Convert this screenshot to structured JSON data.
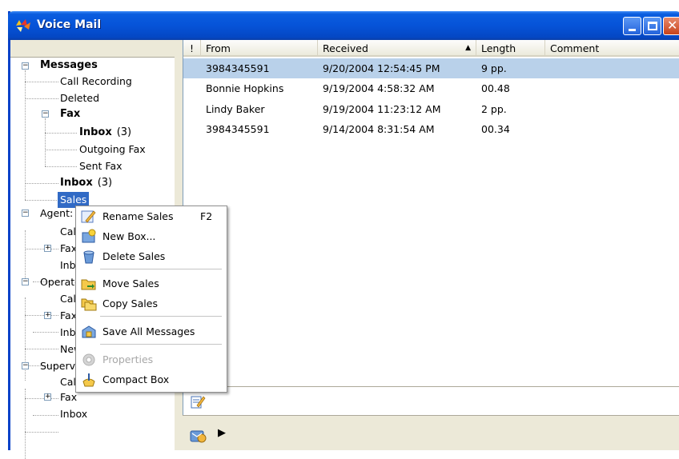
{
  "window": {
    "title": "Voice Mail"
  },
  "tree": {
    "messages": {
      "label": "Messages",
      "call_recording": "Call Recording",
      "deleted": "Deleted",
      "fax": {
        "label": "Fax",
        "inbox": "Inbox",
        "inbox_count": "(3)",
        "outgoing": "Outgoing Fax",
        "sent": "Sent Fax"
      },
      "inbox": "Inbox",
      "inbox_count": "(3)",
      "sales": "Sales"
    },
    "agent": {
      "label": "Agent: I",
      "call": "Call",
      "fax": "Fax",
      "inbox": "Inb"
    },
    "operator": {
      "label": "Operato",
      "call": "Call",
      "fax": "Fax",
      "inbox": "Inb",
      "new": "New"
    },
    "supervisor": {
      "label": "Supervi",
      "call": "Call",
      "fax": "Fax",
      "inbox": "Inbox"
    }
  },
  "list": {
    "columns": {
      "flag": "!",
      "from": "From",
      "received": "Received",
      "length": "Length",
      "comment": "Comment"
    },
    "rows": [
      {
        "from": "3984345591",
        "received": "9/20/2004 12:54:45 PM",
        "length": "9 pp.",
        "comment": ""
      },
      {
        "from": "Bonnie Hopkins",
        "received": "9/19/2004 4:58:32 AM",
        "length": "00.48",
        "comment": ""
      },
      {
        "from": "Lindy Baker",
        "received": "9/19/2004 11:23:12 AM",
        "length": "2 pp.",
        "comment": ""
      },
      {
        "from": "3984345591",
        "received": "9/14/2004 8:31:54 AM",
        "length": "00.34",
        "comment": ""
      }
    ]
  },
  "context_menu": {
    "rename": "Rename Sales",
    "rename_key": "F2",
    "new_box": "New Box...",
    "delete": "Delete Sales",
    "move": "Move Sales",
    "copy": "Copy Sales",
    "save_all": "Save All Messages",
    "properties": "Properties",
    "compact": "Compact Box"
  },
  "colors": {
    "titlebar": "#0653d8",
    "selection": "#316ac5",
    "row_highlight": "#b9d1ea"
  }
}
